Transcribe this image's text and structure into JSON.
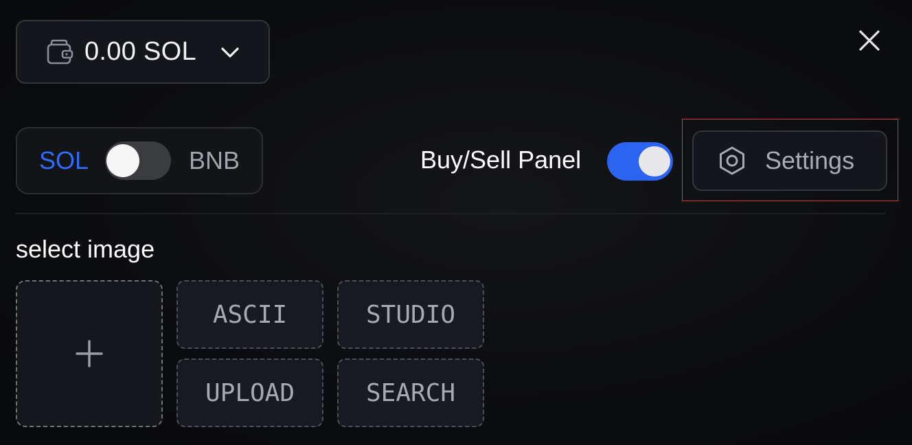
{
  "wallet": {
    "balance": "0.00 SOL",
    "icon": "wallet-icon",
    "dropdown_icon": "chevron-down-icon"
  },
  "close": {
    "icon": "close-icon"
  },
  "chain_toggle": {
    "left_label": "SOL",
    "right_label": "BNB",
    "active": "SOL",
    "active_color": "#2f6bff"
  },
  "buy_sell_panel": {
    "label": "Buy/Sell Panel",
    "enabled": true,
    "on_color": "#2b64f0"
  },
  "settings": {
    "label": "Settings",
    "icon": "gear-icon",
    "highlight_color": "#d43a2a"
  },
  "image_section": {
    "title": "select image",
    "add_icon": "plus-icon",
    "sources": [
      {
        "label": "ASCII"
      },
      {
        "label": "STUDIO"
      },
      {
        "label": "UPLOAD"
      },
      {
        "label": "SEARCH"
      }
    ]
  }
}
